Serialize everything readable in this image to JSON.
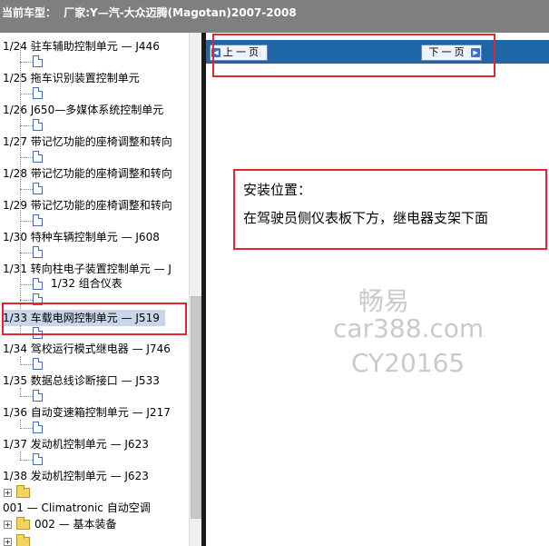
{
  "header": {
    "label": "当前车型：",
    "vehicle": "厂家:Y—汽-大众迈腾(Magotan)2007-2008"
  },
  "tree": {
    "items": [
      {
        "label": "1/24 驻车辅助控制单元 — J446"
      },
      {
        "label": "1/25 拖车识别装置控制单元"
      },
      {
        "label": "1/26 J650—多媒体系统控制单元"
      },
      {
        "label": "1/27 带记忆功能的座椅调整和转向"
      },
      {
        "label": "1/28 带记忆功能的座椅调整和转向"
      },
      {
        "label": "1/29 带记忆功能的座椅调整和转向"
      },
      {
        "label": "1/30 特种车辆控制单元 — J608"
      },
      {
        "label": "1/31 转向柱电子装置控制单元 — J"
      },
      {
        "label": "1/32 组合仪表"
      },
      {
        "label": "1/33 车载电网控制单元 — J519"
      },
      {
        "label": "1/34 驾校运行模式继电器 — J746"
      },
      {
        "label": "1/35 数据总线诊断接口 — J533"
      },
      {
        "label": "1/36 自动变速箱控制单元 — J217"
      },
      {
        "label": "1/37 发动机控制单元 — J623"
      },
      {
        "label": "1/38 发动机控制单元 — J623"
      },
      {
        "label": "001 — Climatronic 自动空调"
      },
      {
        "label": "002 — 基本装备"
      }
    ]
  },
  "nav": {
    "prev_label": "上一页",
    "next_label": "下一页"
  },
  "content": {
    "title": "安装位置：",
    "text": "在驾驶员侧仪表板下方，继电器支架下面"
  },
  "watermark": {
    "line1": "畅易",
    "line2": "car388.com",
    "line3": "CY20165"
  },
  "colors": {
    "titlebar": "#7f7f7f",
    "navbar": "#1f66a6",
    "highlight": "#e0262e",
    "selection": "#c9d6ea"
  }
}
